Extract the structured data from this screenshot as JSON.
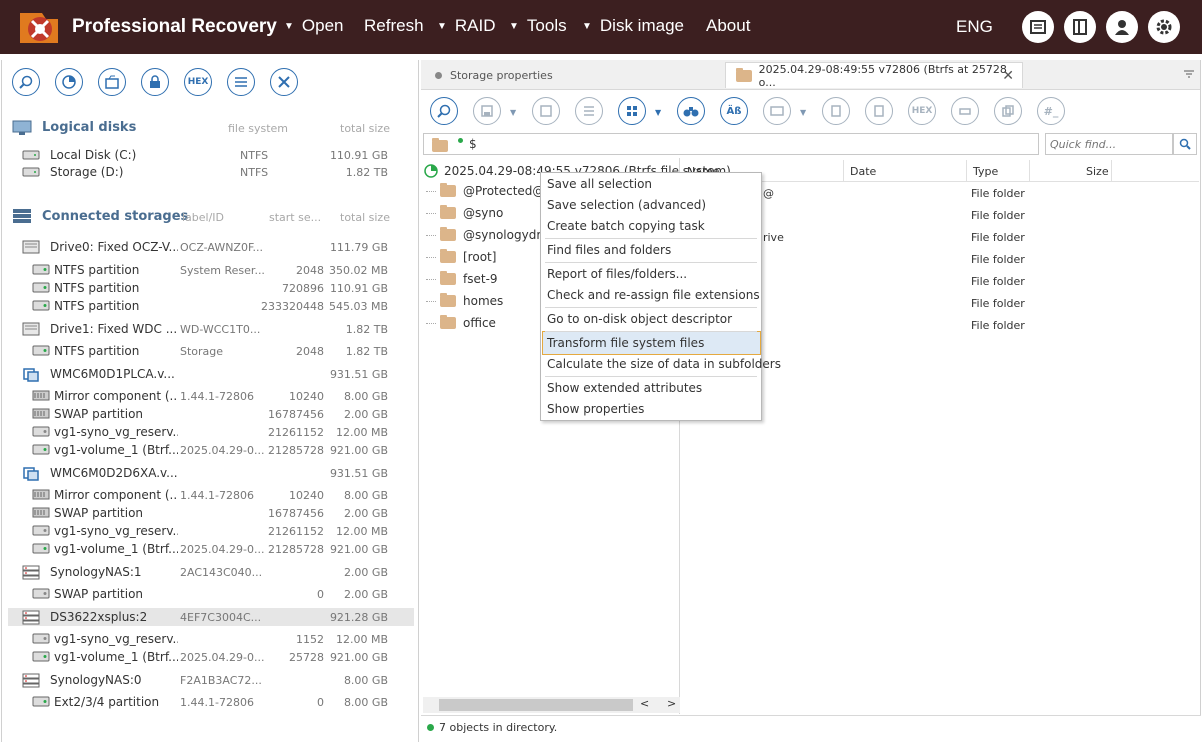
{
  "app": {
    "title": "Professional Recovery",
    "lang": "ENG"
  },
  "menu": [
    {
      "label": "Open",
      "arrow": true
    },
    {
      "label": "Refresh",
      "arrow": false
    },
    {
      "label": "RAID",
      "arrow": true
    },
    {
      "label": "Tools",
      "arrow": true
    },
    {
      "label": "Disk image",
      "arrow": true
    },
    {
      "label": "About",
      "arrow": false
    }
  ],
  "left": {
    "logical_title": "Logical disks",
    "col_fs": "file system",
    "col_size": "total size",
    "logical": [
      {
        "name": "Local Disk (C:)",
        "fs": "NTFS",
        "size": "110.91 GB"
      },
      {
        "name": "Storage (D:)",
        "fs": "NTFS",
        "size": "1.82 TB"
      }
    ],
    "connected_title": "Connected storages",
    "col_label": "label/ID",
    "col_start": "start se...",
    "storages": [
      {
        "name": "Drive0: Fixed OCZ-V...",
        "label": "OCZ-AWNZ0F...",
        "start": "",
        "size": "111.79 GB",
        "lvl": 0,
        "icon": "drive"
      },
      {
        "name": "NTFS partition",
        "label": "System Reser...",
        "start": "2048",
        "size": "350.02 MB",
        "lvl": 1,
        "icon": "part"
      },
      {
        "name": "NTFS partition",
        "label": "",
        "start": "720896",
        "size": "110.91 GB",
        "lvl": 1,
        "icon": "part"
      },
      {
        "name": "NTFS partition",
        "label": "",
        "start": "233320448",
        "size": "545.03 MB",
        "lvl": 1,
        "icon": "part"
      },
      {
        "name": "Drive1: Fixed WDC ...",
        "label": "WD-WCC1T0...",
        "start": "",
        "size": "1.82 TB",
        "lvl": 0,
        "icon": "drive"
      },
      {
        "name": "NTFS partition",
        "label": "Storage",
        "start": "2048",
        "size": "1.82 TB",
        "lvl": 1,
        "icon": "part"
      },
      {
        "name": "WMC6M0D1PLCA.v...",
        "label": "",
        "start": "",
        "size": "931.51 GB",
        "lvl": 0,
        "icon": "vdisk"
      },
      {
        "name": "Mirror component (...",
        "label": "1.44.1-72806",
        "start": "10240",
        "size": "8.00 GB",
        "lvl": 1,
        "icon": "raid"
      },
      {
        "name": "SWAP partition",
        "label": "",
        "start": "16787456",
        "size": "2.00 GB",
        "lvl": 1,
        "icon": "raid"
      },
      {
        "name": "vg1-syno_vg_reserv...",
        "label": "",
        "start": "21261152",
        "size": "12.00 MB",
        "lvl": 1,
        "icon": "gray"
      },
      {
        "name": "vg1-volume_1 (Btrf...",
        "label": "2025.04.29-0...",
        "start": "21285728",
        "size": "921.00 GB",
        "lvl": 1,
        "icon": "part"
      },
      {
        "name": "WMC6M0D2D6XA.v...",
        "label": "",
        "start": "",
        "size": "931.51 GB",
        "lvl": 0,
        "icon": "vdisk"
      },
      {
        "name": "Mirror component (...",
        "label": "1.44.1-72806",
        "start": "10240",
        "size": "8.00 GB",
        "lvl": 1,
        "icon": "raid"
      },
      {
        "name": "SWAP partition",
        "label": "",
        "start": "16787456",
        "size": "2.00 GB",
        "lvl": 1,
        "icon": "raid"
      },
      {
        "name": "vg1-syno_vg_reserv...",
        "label": "",
        "start": "21261152",
        "size": "12.00 MB",
        "lvl": 1,
        "icon": "gray"
      },
      {
        "name": "vg1-volume_1 (Btrf...",
        "label": "2025.04.29-0...",
        "start": "21285728",
        "size": "921.00 GB",
        "lvl": 1,
        "icon": "part"
      },
      {
        "name": "SynologyNAS:1",
        "label": "2AC143C040...",
        "start": "",
        "size": "2.00 GB",
        "lvl": 0,
        "icon": "nas"
      },
      {
        "name": "SWAP partition",
        "label": "",
        "start": "0",
        "size": "2.00 GB",
        "lvl": 1,
        "icon": "gray"
      },
      {
        "name": "DS3622xsplus:2",
        "label": "4EF7C3004C...",
        "start": "",
        "size": "921.28 GB",
        "lvl": 0,
        "icon": "nas",
        "selected": true
      },
      {
        "name": "vg1-syno_vg_reserv...",
        "label": "",
        "start": "1152",
        "size": "12.00 MB",
        "lvl": 1,
        "icon": "gray"
      },
      {
        "name": "vg1-volume_1 (Btrf...",
        "label": "2025.04.29-0...",
        "start": "25728",
        "size": "921.00 GB",
        "lvl": 1,
        "icon": "part"
      },
      {
        "name": "SynologyNAS:0",
        "label": "F2A1B3AC72...",
        "start": "",
        "size": "8.00 GB",
        "lvl": 0,
        "icon": "nas"
      },
      {
        "name": "Ext2/3/4 partition",
        "label": "1.44.1-72806",
        "start": "0",
        "size": "8.00 GB",
        "lvl": 1,
        "icon": "part"
      }
    ]
  },
  "tabs": {
    "storage": "Storage properties",
    "active": "2025.04.29-08:49:55 v72806 (Btrfs at 25728 o..."
  },
  "path": "$",
  "quick_find": "Quick find...",
  "tree_root": "2025.04.29-08:49:55 v72806 (Btrfs file system)",
  "folders": [
    "@Protected@",
    "@syno",
    "@synologydrive",
    "[root]",
    "fset-9",
    "homes",
    "office"
  ],
  "list": {
    "cols": {
      "name": "Name",
      "date": "Date",
      "type": "Type",
      "size": "Size"
    },
    "name_frag": [
      "d@",
      "drive"
    ],
    "type": "File folder"
  },
  "context_menu": [
    "Save all selection",
    "Save selection (advanced)",
    "Create batch copying task",
    "Find files and folders",
    "Report of files/folders...",
    "Check and re-assign file extensions",
    "Go to on-disk object descriptor",
    "Transform file system files",
    "Calculate the size of data in subfolders",
    "Show extended attributes",
    "Show properties"
  ],
  "status": "7 objects in directory.",
  "hex": "HEX"
}
